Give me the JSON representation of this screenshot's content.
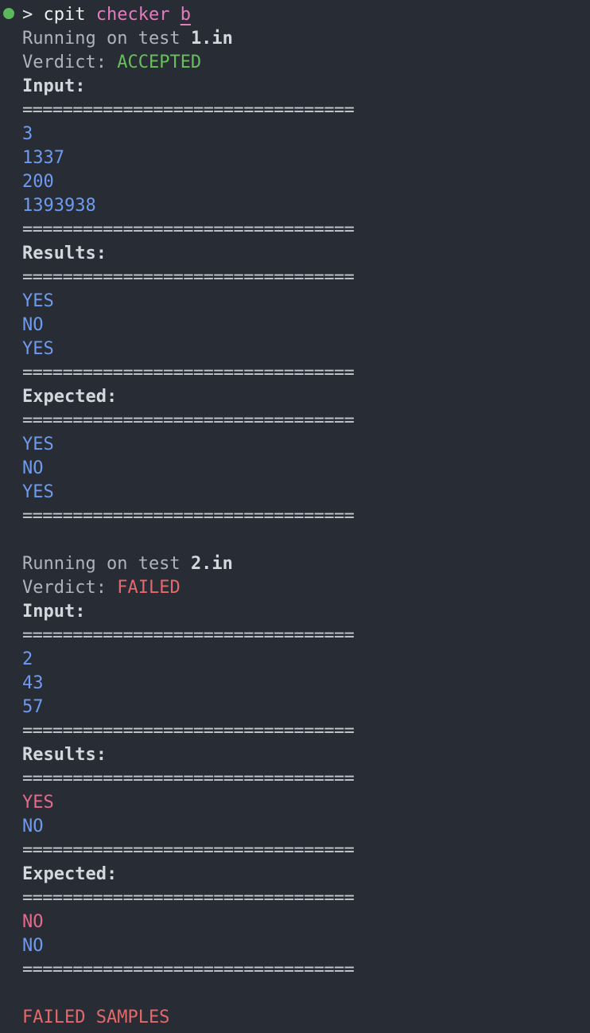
{
  "prompt": {
    "symbol": ">",
    "command": "cpit",
    "subcommand": "checker",
    "argument": "b"
  },
  "separator": "=================================",
  "tests": [
    {
      "running_prefix": "Running on test",
      "file": "1.in",
      "verdict_label": "Verdict:",
      "verdict": "ACCEPTED",
      "input_label": "Input:",
      "input": [
        "3",
        "1337",
        "200",
        "1393938"
      ],
      "results_label": "Results:",
      "results": [
        "YES",
        "NO",
        "YES"
      ],
      "expected_label": "Expected:",
      "expected": [
        "YES",
        "NO",
        "YES"
      ]
    },
    {
      "running_prefix": "Running on test",
      "file": "2.in",
      "verdict_label": "Verdict:",
      "verdict": "FAILED",
      "input_label": "Input:",
      "input": [
        "2",
        "43",
        "57"
      ],
      "results_label": "Results:",
      "results": [
        "YES",
        "NO"
      ],
      "expected_label": "Expected:",
      "expected": [
        "NO",
        "NO"
      ]
    }
  ],
  "summary": "FAILED SAMPLES",
  "colors": {
    "background": "#282c34",
    "accepted": "#67c05a",
    "failed": "#e5686a",
    "value": "#6e9bf0",
    "mismatch": "#e8698b",
    "status_dot": "#5cb85c"
  }
}
